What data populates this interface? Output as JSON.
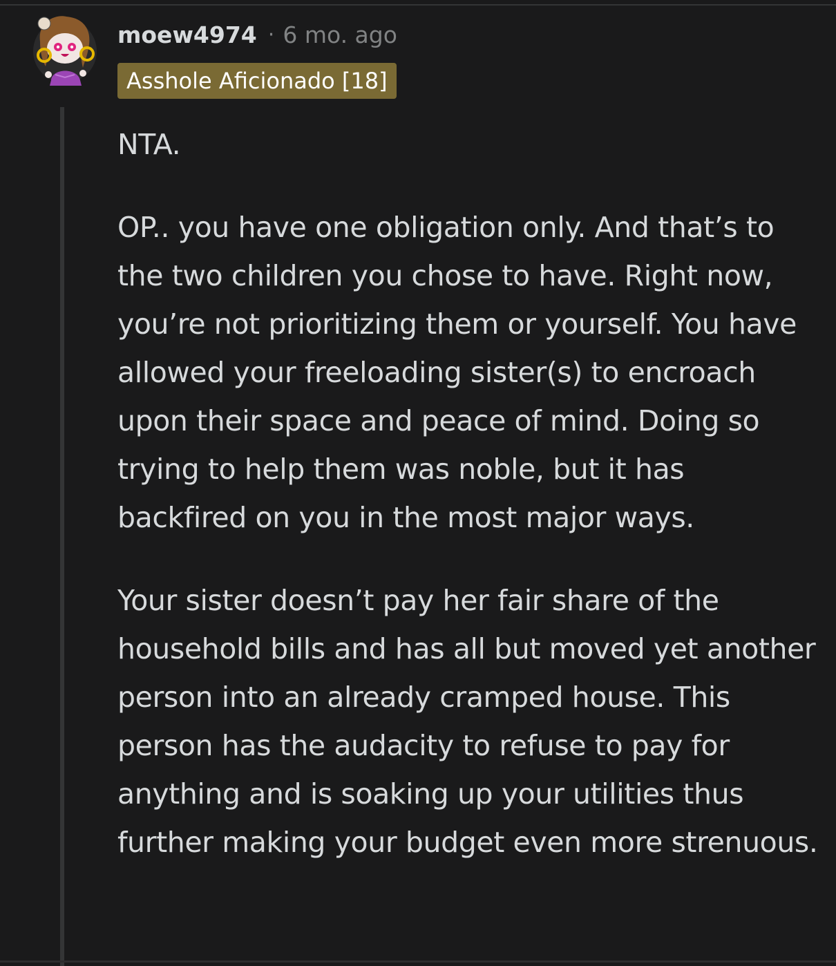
{
  "comment": {
    "author": "moew4974",
    "separator": "·",
    "timestamp": "6 mo. ago",
    "flair": "Asshole Aficionado [18]",
    "paragraphs": [
      "NTA.",
      "OP.. you have one obligation only. And that’s to the two children you chose to have. Right now, you’re not prioritizing them or yourself. You have allowed your freeloading sister(s) to encroach upon their space and peace of mind. Doing so trying to help them was noble, but it has backfired on you in the most major ways.",
      "Your sister doesn’t pay her fair share of the household bills and has all but moved yet another person into an already cramped house. This person has the audacity to refuse to pay for anything and is soaking up your utilities thus further making your budget even more strenuous."
    ]
  },
  "colors": {
    "background": "#1a1a1b",
    "text": "#d7dadc",
    "meta": "#818384",
    "flair_bg": "#7a6a34",
    "thread_line": "#343536"
  },
  "icons": {
    "avatar": "user-avatar-snoo"
  }
}
